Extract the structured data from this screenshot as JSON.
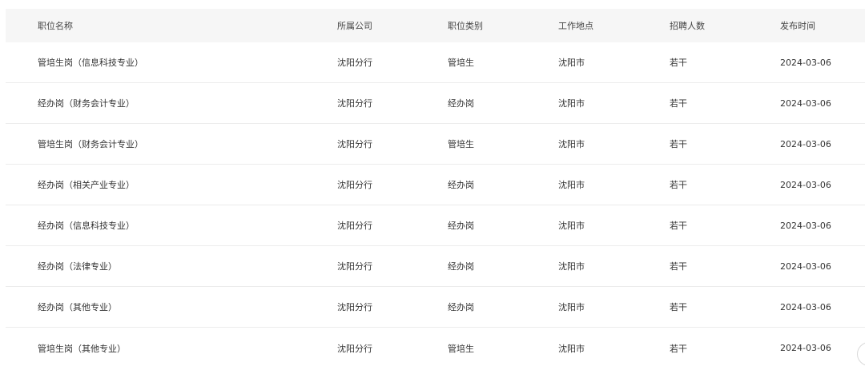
{
  "table": {
    "headers": [
      "职位名称",
      "所属公司",
      "职位类别",
      "工作地点",
      "招聘人数",
      "发布时间"
    ],
    "rows": [
      [
        "管培生岗（信息科技专业）",
        "沈阳分行",
        "管培生",
        "沈阳市",
        "若干",
        "2024-03-06"
      ],
      [
        "经办岗（财务会计专业）",
        "沈阳分行",
        "经办岗",
        "沈阳市",
        "若干",
        "2024-03-06"
      ],
      [
        "管培生岗（财务会计专业）",
        "沈阳分行",
        "管培生",
        "沈阳市",
        "若干",
        "2024-03-06"
      ],
      [
        "经办岗（相关产业专业）",
        "沈阳分行",
        "经办岗",
        "沈阳市",
        "若干",
        "2024-03-06"
      ],
      [
        "经办岗（信息科技专业）",
        "沈阳分行",
        "经办岗",
        "沈阳市",
        "若干",
        "2024-03-06"
      ],
      [
        "经办岗（法律专业）",
        "沈阳分行",
        "经办岗",
        "沈阳市",
        "若干",
        "2024-03-06"
      ],
      [
        "经办岗（其他专业）",
        "沈阳分行",
        "经办岗",
        "沈阳市",
        "若干",
        "2024-03-06"
      ],
      [
        "管培生岗（其他专业）",
        "沈阳分行",
        "管培生",
        "沈阳市",
        "若干",
        "2024-03-06"
      ]
    ]
  },
  "colors": {
    "header_bg": "#f6f6f6",
    "text": "#333333",
    "row_divider": "#ececec"
  }
}
